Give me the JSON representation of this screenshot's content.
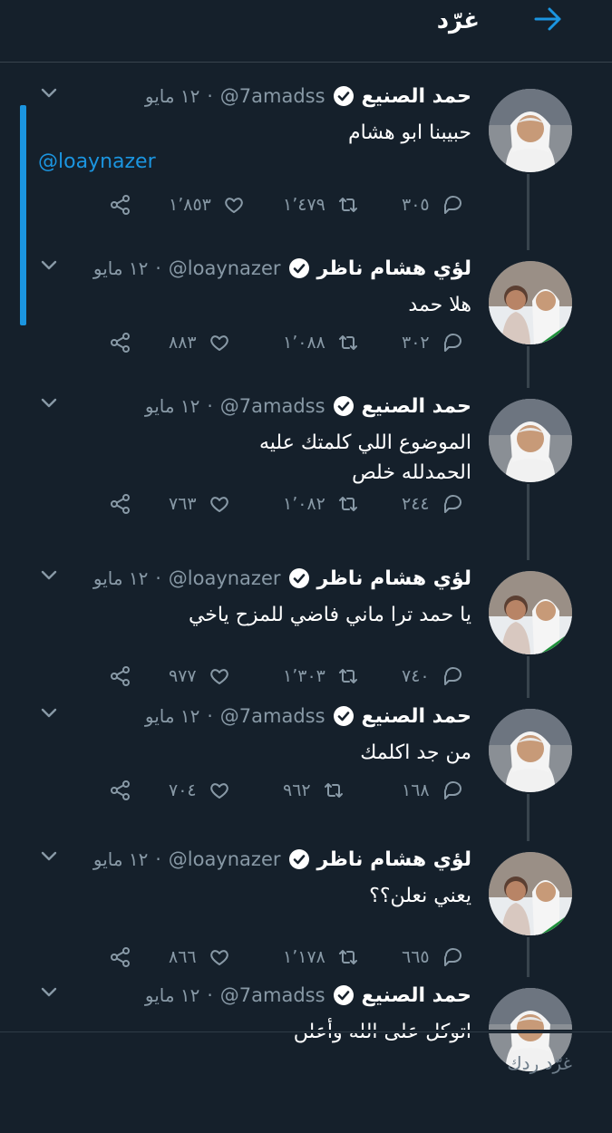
{
  "header": {
    "title": "غرّد"
  },
  "tweets": [
    {
      "name": "حمد الصنيع",
      "handle": "@7amadss",
      "date": "١٢ مايو",
      "text": "حبيبنا ابو هشام",
      "mention": "@loaynazer",
      "replies": "٣٠٥",
      "retweets": "١٬٤٧٩",
      "likes": "١٬٨٥٣"
    },
    {
      "name": "لؤي هشام ناظر",
      "handle": "@loaynazer",
      "date": "١٢ مايو",
      "text": "هلا حمد",
      "replies": "٣٠٢",
      "retweets": "١٬٠٨٨",
      "likes": "٨٨٣"
    },
    {
      "name": "حمد الصنيع",
      "handle": "@7amadss",
      "date": "١٢ مايو",
      "text": "الموضوع اللي كلمتك عليه\nالحمدلله خلص",
      "replies": "٢٤٤",
      "retweets": "١٬٠٨٢",
      "likes": "٧٦٣"
    },
    {
      "name": "لؤي هشام ناظر",
      "handle": "@loaynazer",
      "date": "١٢ مايو",
      "text": "يا حمد ترا ماني فاضي للمزح ياخي",
      "replies": "٧٤٠",
      "retweets": "١٬٣٠٣",
      "likes": "٩٧٧"
    },
    {
      "name": "حمد الصنيع",
      "handle": "@7amadss",
      "date": "١٢ مايو",
      "text": "من جد اكلمك",
      "replies": "١٦٨",
      "retweets": "٩٦٢",
      "likes": "٧٠٤"
    },
    {
      "name": "لؤي هشام ناظر",
      "handle": "@loaynazer",
      "date": "١٢ مايو",
      "text": "يعني نعلن؟؟",
      "replies": "٦٦٥",
      "retweets": "١٬١٧٨",
      "likes": "٨٦٦"
    },
    {
      "name": "حمد الصنيع",
      "handle": "@7amadss",
      "date": "١٢ مايو",
      "text": "اتوكل على الله وأعلن"
    }
  ],
  "separator": "·",
  "reply_box": {
    "placeholder": "غرّد ردك"
  },
  "colors": {
    "background": "#15202b",
    "accent": "#1b95e0",
    "muted": "#8899a6"
  }
}
